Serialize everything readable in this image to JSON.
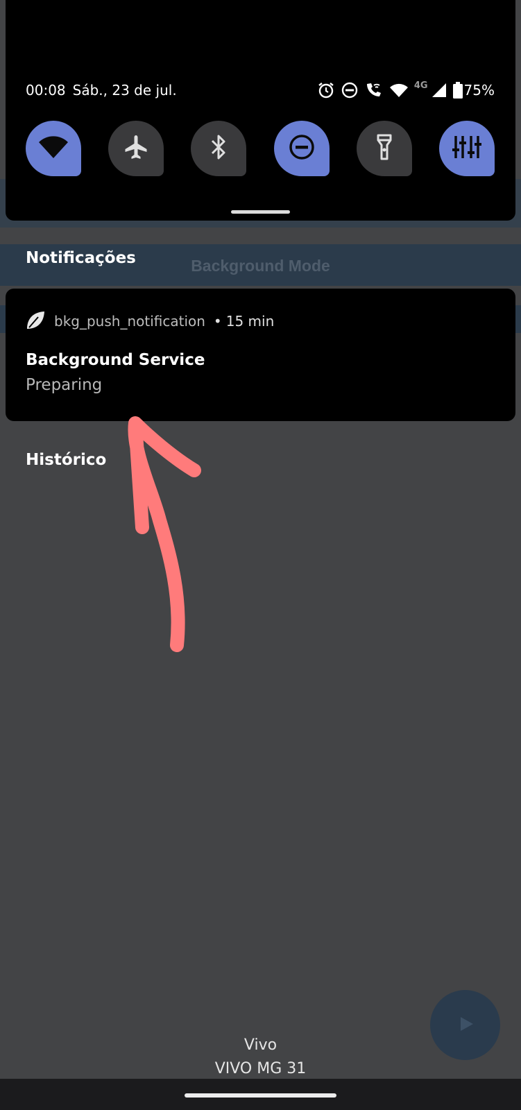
{
  "status": {
    "time": "00:08",
    "date": "Sáb., 23 de jul.",
    "network": "4G",
    "battery": "75%"
  },
  "quick_tiles": [
    {
      "name": "wifi",
      "active": true
    },
    {
      "name": "airplane",
      "active": false
    },
    {
      "name": "bluetooth",
      "active": false
    },
    {
      "name": "do-not-disturb",
      "active": true
    },
    {
      "name": "flashlight",
      "active": false
    },
    {
      "name": "equalizer",
      "active": true
    }
  ],
  "background_app": {
    "title": "Background Mode"
  },
  "sections": {
    "notifications": "Notificações",
    "history": "Histórico"
  },
  "notification": {
    "app": "bkg_push_notification",
    "separator": "•",
    "time": "15 min",
    "title": "Background Service",
    "text": "Preparing"
  },
  "carrier": {
    "line1": "Vivo",
    "line2": "VIVO MG 31"
  },
  "colors": {
    "tile_active": "#6a7fd4",
    "tile_inactive": "#3a3a3c",
    "annotation_arrow": "#ff7b7b",
    "shade_bg": "#434446"
  }
}
